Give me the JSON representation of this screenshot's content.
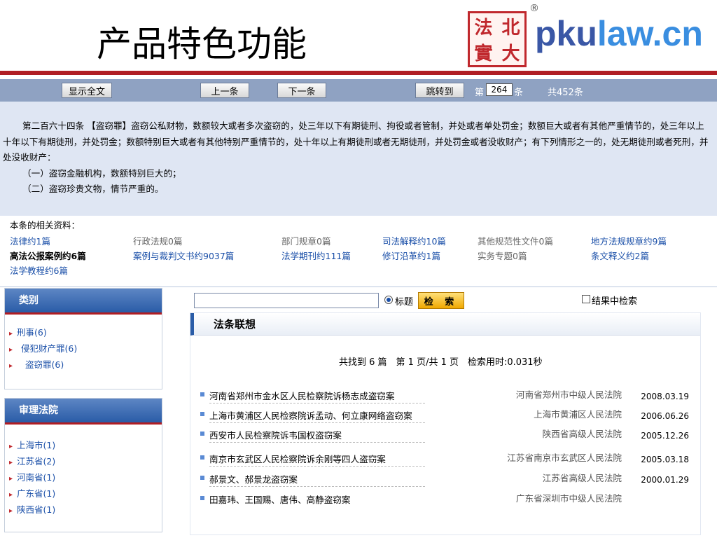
{
  "slide": {
    "title": "产品特色功能"
  },
  "logo": {
    "seal_chars": [
      "法",
      "北",
      "實",
      "大"
    ],
    "registered": "®",
    "text_pk": "pku",
    "text_law": "law.cn"
  },
  "navbar": {
    "show_full": "显示全文",
    "prev": "上一条",
    "next": "下一条",
    "goto": "跳转到",
    "item_prefix": "第",
    "item_number": "264",
    "item_suffix": "条",
    "total": "共452条"
  },
  "article": {
    "paragraph": "第二百六十四条 【盗窃罪】盗窃公私财物，数额较大或者多次盗窃的，处三年以下有期徒刑、拘役或者管制，并处或者单处罚金；数额巨大或者有其他严重情节的，处三年以上十年以下有期徒刑，并处罚金；数额特别巨大或者有其他特别严重情节的，处十年以上有期徒刑或者无期徒刑，并处罚金或者没收财产；有下列情形之一的，处无期徒刑或者死刑，并处没收财产：",
    "items": [
      "（一）盗窃金融机构，数额特别巨大的；",
      "（二）盗窃珍贵文物，情节严重的。"
    ]
  },
  "related": {
    "heading": "本条的相关资料：",
    "row1": [
      "法律约1篇",
      "行政法规0篇",
      "部门规章0篇",
      "司法解释约10篇",
      "其他规范性文件0篇",
      "地方法规规章约9篇"
    ],
    "row2": [
      "高法公报案例约6篇",
      "案例与裁判文书约9037篇",
      "法学期刊约111篇",
      "修订沿革约1篇",
      "实务专题0篇",
      "条文释义约2篇"
    ],
    "row3": [
      "法学教程约6篇"
    ]
  },
  "category": {
    "title": "类别",
    "items": [
      "刑事(6)",
      "侵犯财产罪(6)",
      "盗窃罪(6)"
    ]
  },
  "court": {
    "title": "审理法院",
    "items": [
      "上海市(1)",
      "江苏省(2)",
      "河南省(1)",
      "广东省(1)",
      "陕西省(1)"
    ]
  },
  "search": {
    "radio_label": "标题",
    "button": "检 索",
    "checkbox_label": "结果中检索"
  },
  "results": {
    "heading": "法条联想",
    "summary": "共找到 6 篇　第 1 页/共 1 页　检索用时:0.031秒",
    "rows": [
      {
        "title": "河南省郑州市金水区人民检察院诉杨志成盗窃案",
        "court": "河南省郑州市中级人民法院",
        "date": "2008.03.19"
      },
      {
        "title": "上海市黄浦区人民检察院诉孟动、何立康网络盗窃案",
        "court": "上海市黄浦区人民法院",
        "date": "2006.06.26"
      },
      {
        "title": "西安市人民检察院诉韦国权盗窃案",
        "court": "陕西省高级人民法院",
        "date": "2005.12.26"
      },
      {
        "title": "南京市玄武区人民检察院诉余刚等四人盗窃案",
        "court": "江苏省南京市玄武区人民法院",
        "date": "2005.03.18"
      },
      {
        "title": "郝景文、郝景龙盗窃案",
        "court": "江苏省高级人民法院",
        "date": "2000.01.29"
      },
      {
        "title": "田嘉玮、王国赐、唐伟、高静盗窃案",
        "court": "广东省深圳市中级人民法院",
        "date": ""
      }
    ]
  },
  "colors": {
    "brand_red": "#b01e24",
    "nav_blue": "#8fa2c2",
    "link_blue": "#1a4fa8"
  }
}
